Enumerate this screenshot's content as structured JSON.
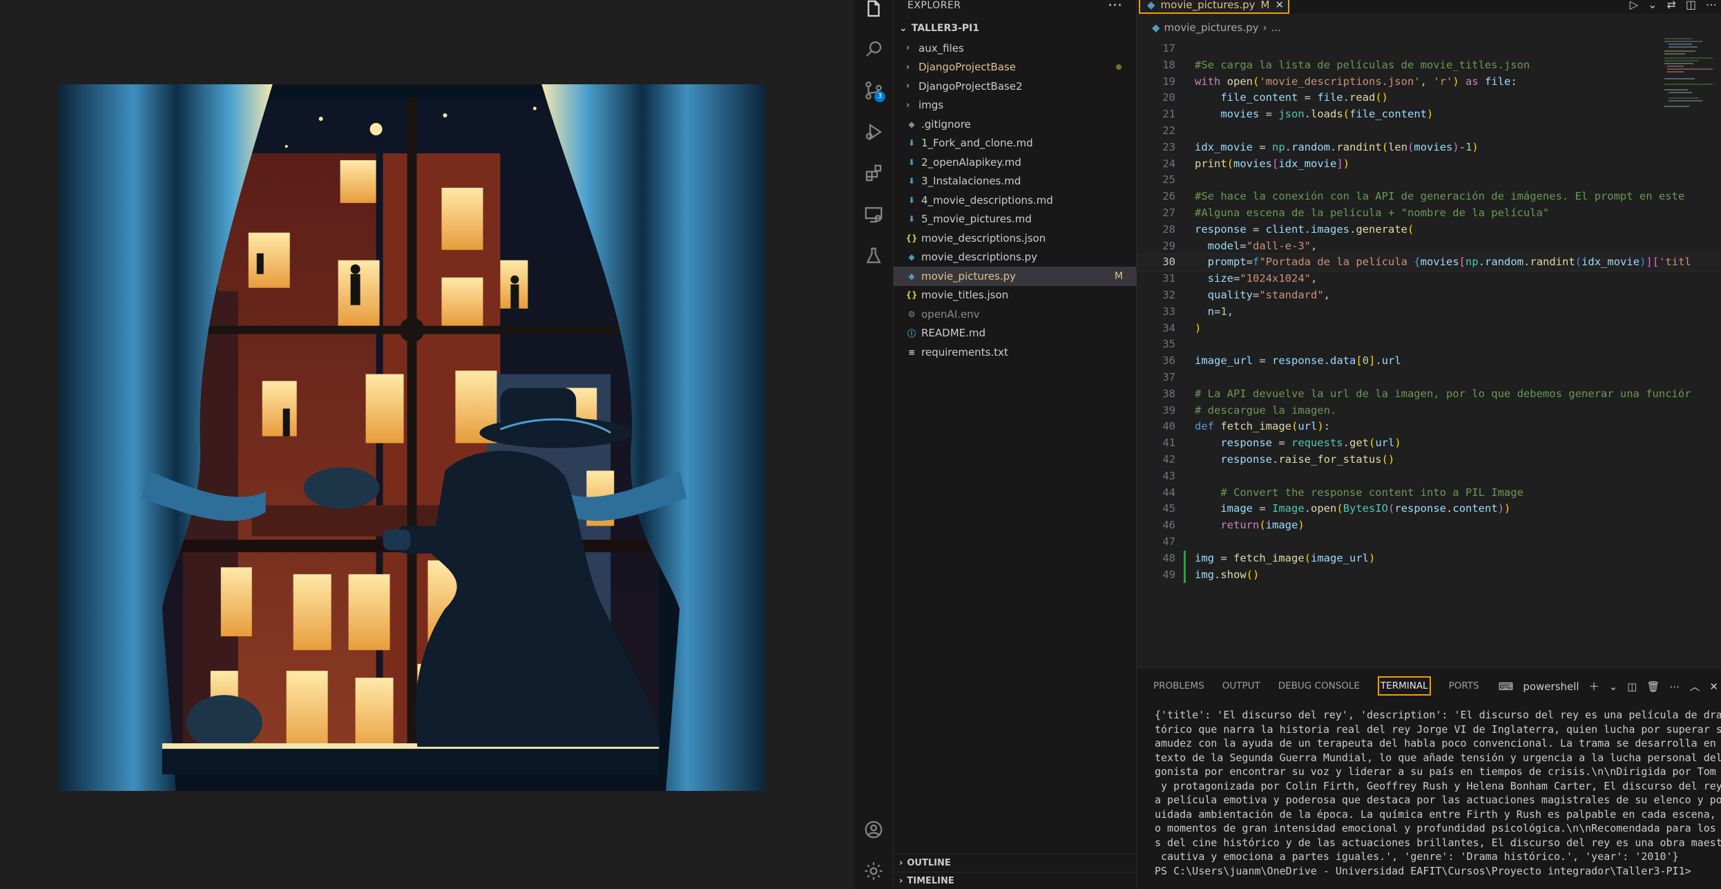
{
  "explorer": {
    "title": "EXPLORER",
    "more": "···",
    "root": "TALLER3-PI1",
    "items": [
      {
        "label": "aux_files",
        "kind": "folder",
        "color": "#cccccc",
        "badge": ""
      },
      {
        "label": "DjangoProjectBase",
        "kind": "folder",
        "color": "#e2c08d",
        "badge": "dot"
      },
      {
        "label": "DjangoProjectBase2",
        "kind": "folder",
        "color": "#cccccc",
        "badge": ""
      },
      {
        "label": "imgs",
        "kind": "folder",
        "color": "#cccccc",
        "badge": ""
      },
      {
        "label": ".gitignore",
        "kind": "git",
        "color": "#cccccc",
        "badge": ""
      },
      {
        "label": "1_Fork_and_clone.md",
        "kind": "md",
        "color": "#cccccc",
        "badge": ""
      },
      {
        "label": "2_openAlapikey.md",
        "kind": "md",
        "color": "#cccccc",
        "badge": ""
      },
      {
        "label": "3_Instalaciones.md",
        "kind": "md",
        "color": "#cccccc",
        "badge": ""
      },
      {
        "label": "4_movie_descriptions.md",
        "kind": "md",
        "color": "#cccccc",
        "badge": ""
      },
      {
        "label": "5_movie_pictures.md",
        "kind": "md",
        "color": "#cccccc",
        "badge": ""
      },
      {
        "label": "movie_descriptions.json",
        "kind": "json",
        "color": "#cccccc",
        "badge": ""
      },
      {
        "label": "movie_descriptions.py",
        "kind": "py",
        "color": "#cccccc",
        "badge": ""
      },
      {
        "label": "movie_pictures.py",
        "kind": "py",
        "color": "#e2c08d",
        "badge": "M"
      },
      {
        "label": "movie_titles.json",
        "kind": "json",
        "color": "#cccccc",
        "badge": ""
      },
      {
        "label": "openAI.env",
        "kind": "env",
        "color": "#8b8b8b",
        "badge": ""
      },
      {
        "label": "README.md",
        "kind": "info",
        "color": "#cccccc",
        "badge": ""
      },
      {
        "label": "requirements.txt",
        "kind": "txt",
        "color": "#cccccc",
        "badge": ""
      }
    ],
    "outline": "OUTLINE",
    "timeline": "TIMELINE"
  },
  "activity": {
    "scm_count": "3"
  },
  "editor": {
    "tab_label": "movie_pictures.py",
    "tab_marker": "M",
    "breadcrumb_file": "movie_pictures.py",
    "breadcrumb_more": "...",
    "lines": [
      {
        "n": "17",
        "html": ""
      },
      {
        "n": "18",
        "html": "<span class='cm'>#Se carga la lista de películas de movie_titles.json</span>"
      },
      {
        "n": "19",
        "html": "<span class='kw'>with</span> <span class='fn'>open</span><span class='br1'>(</span><span class='str'>'movie_descriptions.json'</span>, <span class='str'>'r'</span><span class='br1'>)</span> <span class='kw'>as</span> <span class='var'>file</span>:"
      },
      {
        "n": "20",
        "html": "    <span class='var'>file_content</span> = <span class='var'>file</span>.<span class='fn'>read</span><span class='br1'>()</span>"
      },
      {
        "n": "21",
        "html": "    <span class='var'>movies</span> = <span class='cls'>json</span>.<span class='fn'>loads</span><span class='br1'>(</span><span class='var'>file_content</span><span class='br1'>)</span>"
      },
      {
        "n": "22",
        "html": ""
      },
      {
        "n": "23",
        "html": "<span class='var'>idx_movie</span> = <span class='cls'>np</span>.<span class='var'>random</span>.<span class='fn'>randint</span><span class='br1'>(</span><span class='fn'>len</span><span class='br2'>(</span><span class='var'>movies</span><span class='br2'>)</span>-<span class='num'>1</span><span class='br1'>)</span>"
      },
      {
        "n": "24",
        "html": "<span class='fn'>print</span><span class='br1'>(</span><span class='var'>movies</span><span class='br2'>[</span><span class='var'>idx_movie</span><span class='br2'>]</span><span class='br1'>)</span>"
      },
      {
        "n": "25",
        "html": ""
      },
      {
        "n": "26",
        "html": "<span class='cm'>#Se hace la conexión con la API de generación de imágenes. El prompt en este</span>"
      },
      {
        "n": "27",
        "html": "<span class='cm'>#Alguna escena de la película + \"nombre de la película\"</span>"
      },
      {
        "n": "28",
        "html": "<span class='var'>response</span> = <span class='var'>client</span>.<span class='var'>images</span>.<span class='fn'>generate</span><span class='br1'>(</span>"
      },
      {
        "n": "29",
        "html": "  <span class='var'>model</span>=<span class='str'>\"dall-e-3\"</span>,"
      },
      {
        "n": "30",
        "html": "  <span class='var'>prompt</span>=<span class='kw2'>f</span><span class='str'>\"Portada de la película </span><span class='kw2'>{</span><span class='var'>movies</span><span class='br2'>[</span><span class='cls'>np</span>.<span class='var'>random</span>.<span class='fn'>randint</span><span class='br3'>(</span><span class='var'>idx_movie</span><span class='br3'>)</span><span class='br2'>]</span><span class='br2'>[</span><span class='str'>'titl</span>",
        "hl": true
      },
      {
        "n": "31",
        "html": "  <span class='var'>size</span>=<span class='str'>\"1024x1024\"</span>,"
      },
      {
        "n": "32",
        "html": "  <span class='var'>quality</span>=<span class='str'>\"standard\"</span>,"
      },
      {
        "n": "33",
        "html": "  <span class='var'>n</span>=<span class='num'>1</span>,"
      },
      {
        "n": "34",
        "html": "<span class='br1'>)</span>"
      },
      {
        "n": "35",
        "html": ""
      },
      {
        "n": "36",
        "html": "<span class='var'>image_url</span> = <span class='var'>response</span>.<span class='var'>data</span><span class='br1'>[</span><span class='num'>0</span><span class='br1'>]</span>.<span class='var'>url</span>"
      },
      {
        "n": "37",
        "html": ""
      },
      {
        "n": "38",
        "html": "<span class='cm'># La API devuelve la url de la imagen, por lo que debemos generar una funciór</span>"
      },
      {
        "n": "39",
        "html": "<span class='cm'># descargue la imagen.</span>"
      },
      {
        "n": "40",
        "html": "<span class='kw2'>def</span> <span class='fn'>fetch_image</span><span class='br1'>(</span><span class='var'>url</span><span class='br1'>)</span>:"
      },
      {
        "n": "41",
        "html": "    <span class='var'>response</span> = <span class='cls'>requests</span>.<span class='fn'>get</span><span class='br1'>(</span><span class='var'>url</span><span class='br1'>)</span>"
      },
      {
        "n": "42",
        "html": "    <span class='var'>response</span>.<span class='fn'>raise_for_status</span><span class='br1'>()</span>"
      },
      {
        "n": "43",
        "html": ""
      },
      {
        "n": "44",
        "html": "    <span class='cm'># Convert the response content into a PIL Image</span>"
      },
      {
        "n": "45",
        "html": "    <span class='var'>image</span> = <span class='cls'>Image</span>.<span class='fn'>open</span><span class='br1'>(</span><span class='cls'>BytesIO</span><span class='br2'>(</span><span class='var'>response</span>.<span class='var'>content</span><span class='br2'>)</span><span class='br1'>)</span>"
      },
      {
        "n": "46",
        "html": "    <span class='kw'>return</span><span class='br1'>(</span><span class='var'>image</span><span class='br1'>)</span>"
      },
      {
        "n": "47",
        "html": ""
      },
      {
        "n": "48",
        "html": "<span class='var'>img</span> = <span class='fn'>fetch_image</span><span class='br1'>(</span><span class='var'>image_url</span><span class='br1'>)</span>",
        "mod": true
      },
      {
        "n": "49",
        "html": "<span class='var'>img</span>.<span class='fn'>show</span><span class='br1'>()</span>",
        "mod": true
      }
    ]
  },
  "panel": {
    "tabs": [
      "PROBLEMS",
      "OUTPUT",
      "DEBUG CONSOLE",
      "TERMINAL",
      "PORTS"
    ],
    "active_tab": "TERMINAL",
    "shell": "powershell",
    "terminal_lines": [
      "{'title': 'El discurso del rey', 'description': 'El discurso del rey es una película de drama his",
      "tórico que narra la historia real del rey Jorge VI de Inglaterra, quien lucha por superar su tart",
      "amudez con la ayuda de un terapeuta del habla poco convencional. La trama se desarrolla en el con",
      "texto de la Segunda Guerra Mundial, lo que añade tensión y urgencia a la lucha personal del prota",
      "gonista por encontrar su voz y liderar a su país en tiempos de crisis.\\n\\nDirigida por Tom Hooper",
      " y protagonizada por Colin Firth, Geoffrey Rush y Helena Bonham Carter, El discurso del rey es un",
      "a película emotiva y poderosa que destaca por las actuaciones magistrales de su elenco y por su c",
      "uidada ambientación de la época. La química entre Firth y Rush es palpable en cada escena, cread",
      "o momentos de gran intensidad emocional y profundidad psicológica.\\n\\nRecomendada para los amante",
      "s del cine histórico y de las actuaciones brillantes, El discurso del rey es una obra maestra que",
      " cautiva y emociona a partes iguales.', 'genre': 'Drama histórico.', 'year': '2010'}",
      "PS C:\\Users\\juanm\\OneDrive - Universidad EAFIT\\Cursos\\Proyecto integrador\\Taller3-PI1> "
    ]
  }
}
